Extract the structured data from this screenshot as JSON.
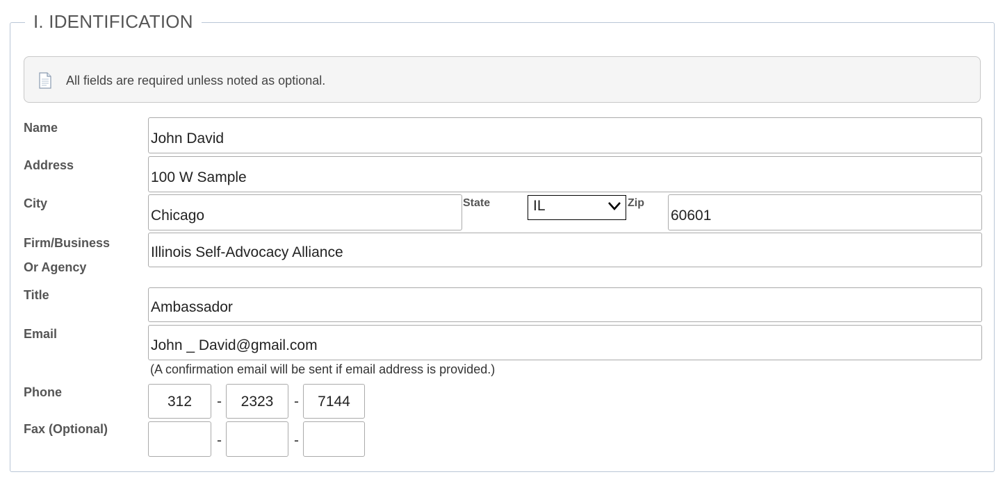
{
  "section": {
    "title": "I. IDENTIFICATION"
  },
  "notice": {
    "icon": "document-icon",
    "text": "All fields are required unless noted as optional."
  },
  "fields": {
    "name": {
      "label": "Name",
      "value": "John David"
    },
    "address": {
      "label": "Address",
      "value": "100 W Sample"
    },
    "city": {
      "label": "City",
      "value": "Chicago"
    },
    "state": {
      "label": "State",
      "value": "IL"
    },
    "zip": {
      "label": "Zip",
      "value": "60601"
    },
    "firm_line1": "Firm/Business",
    "firm_line2": "Or Agency",
    "firm": {
      "value": "Illinois Self-Advocacy Alliance"
    },
    "title": {
      "label": "Title",
      "value": "Ambassador"
    },
    "email": {
      "label": "Email",
      "value": "John _ David@gmail.com",
      "note": "(A confirmation email will be sent if email address is provided.)"
    },
    "phone": {
      "label": "Phone",
      "area": "312",
      "prefix": "2323",
      "line": "7144"
    },
    "fax": {
      "label": "Fax (Optional)",
      "area": "",
      "prefix": "",
      "line": ""
    }
  },
  "separator": "-"
}
